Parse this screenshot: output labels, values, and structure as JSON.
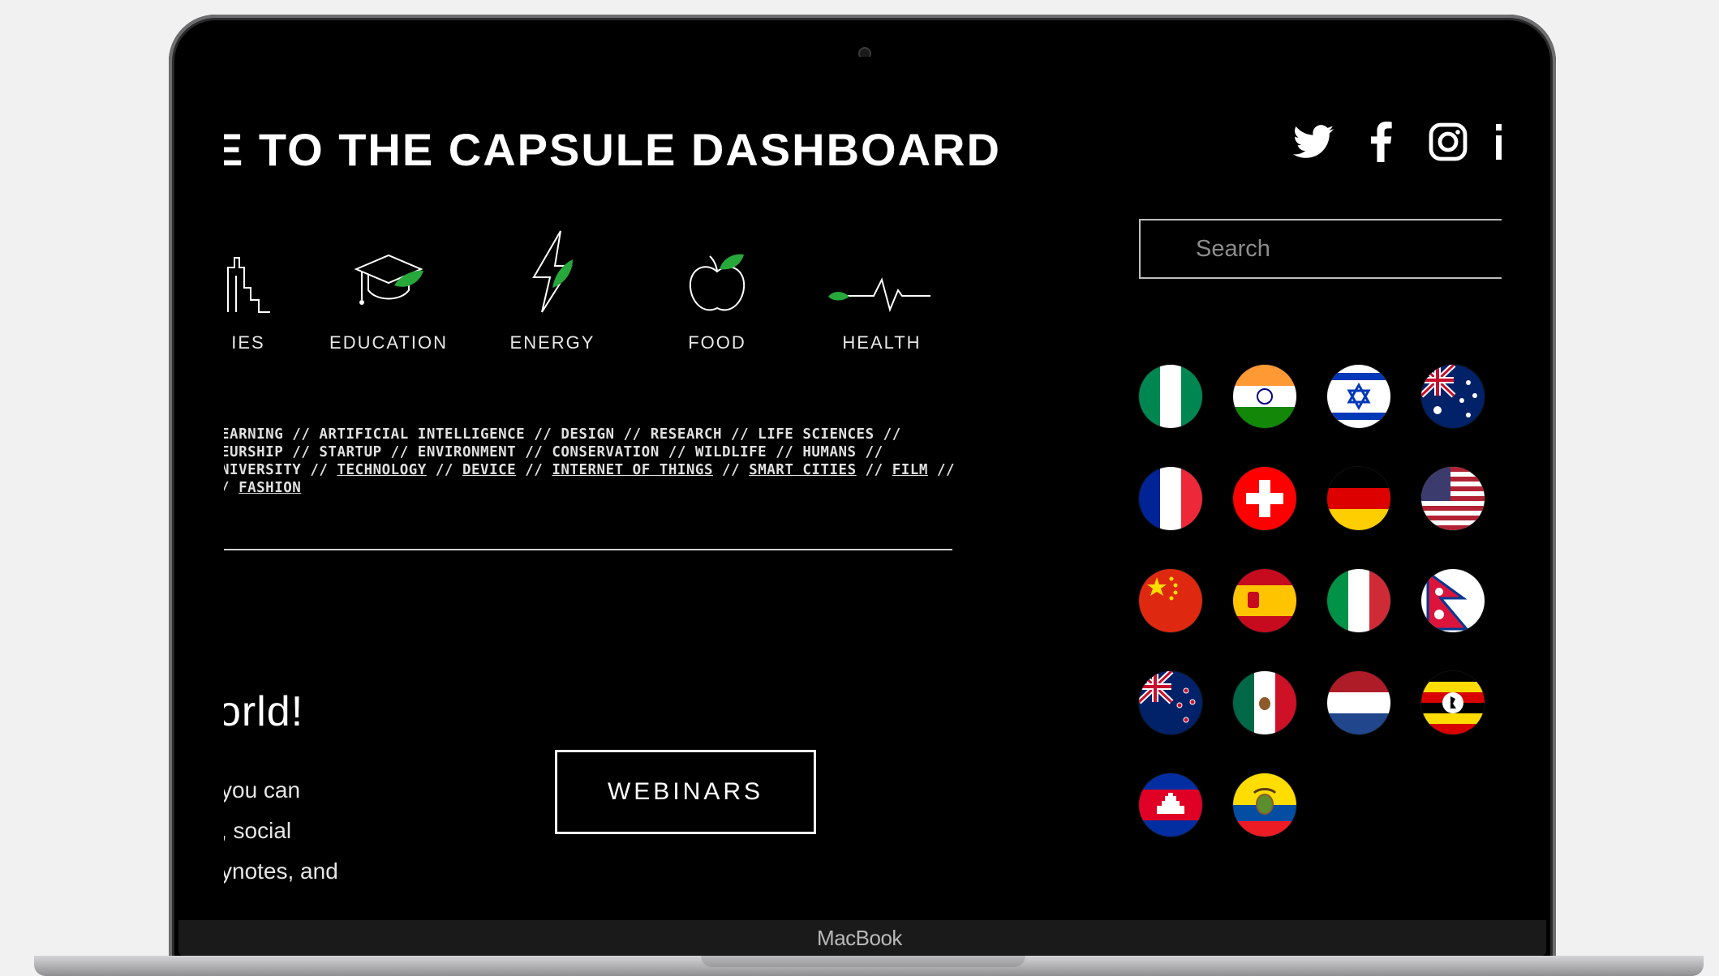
{
  "device": {
    "brand_label": "MacBook"
  },
  "header": {
    "title": "E TO THE CAPSULE DASHBOARD",
    "social": [
      "twitter-icon",
      "facebook-icon",
      "instagram-icon",
      "linkedin-icon"
    ]
  },
  "search": {
    "placeholder": "Search"
  },
  "categories": [
    {
      "label": "IES",
      "icon": "cities-icon"
    },
    {
      "label": "EDUCATION",
      "icon": "graduation-cap-icon"
    },
    {
      "label": "ENERGY",
      "icon": "lightning-icon"
    },
    {
      "label": "FOOD",
      "icon": "apple-icon"
    },
    {
      "label": "HEALTH",
      "icon": "heartbeat-icon"
    }
  ],
  "tags": {
    "line1": "EARNING // ARTIFICIAL INTELLIGENCE // DESIGN // RESEARCH // LIFE SCIENCES //",
    "line2": "EURSHIP // STARTUP // ENVIRONMENT // CONSERVATION // WILDLIFE // HUMANS //",
    "line3_prefix": "NIVERSITY // ",
    "line3_links": [
      "TECHNOLOGY",
      "DEVICE",
      "INTERNET OF THINGS",
      "SMART CITIES",
      "FILM"
    ],
    "line4_prefix": "/ ",
    "line4_link": "FASHION",
    "separator": " // "
  },
  "hero": {
    "heading": "orld!",
    "body": [
      "you can",
      ", social",
      "ynotes, and"
    ],
    "cta": "WEBINARS"
  },
  "flags": [
    "nigeria",
    "india",
    "israel",
    "australia",
    "france",
    "switzerland",
    "germany",
    "usa",
    "china",
    "spain",
    "italy",
    "nepal",
    "new-zealand",
    "mexico",
    "netherlands",
    "uganda",
    "cambodia",
    "ecuador"
  ]
}
